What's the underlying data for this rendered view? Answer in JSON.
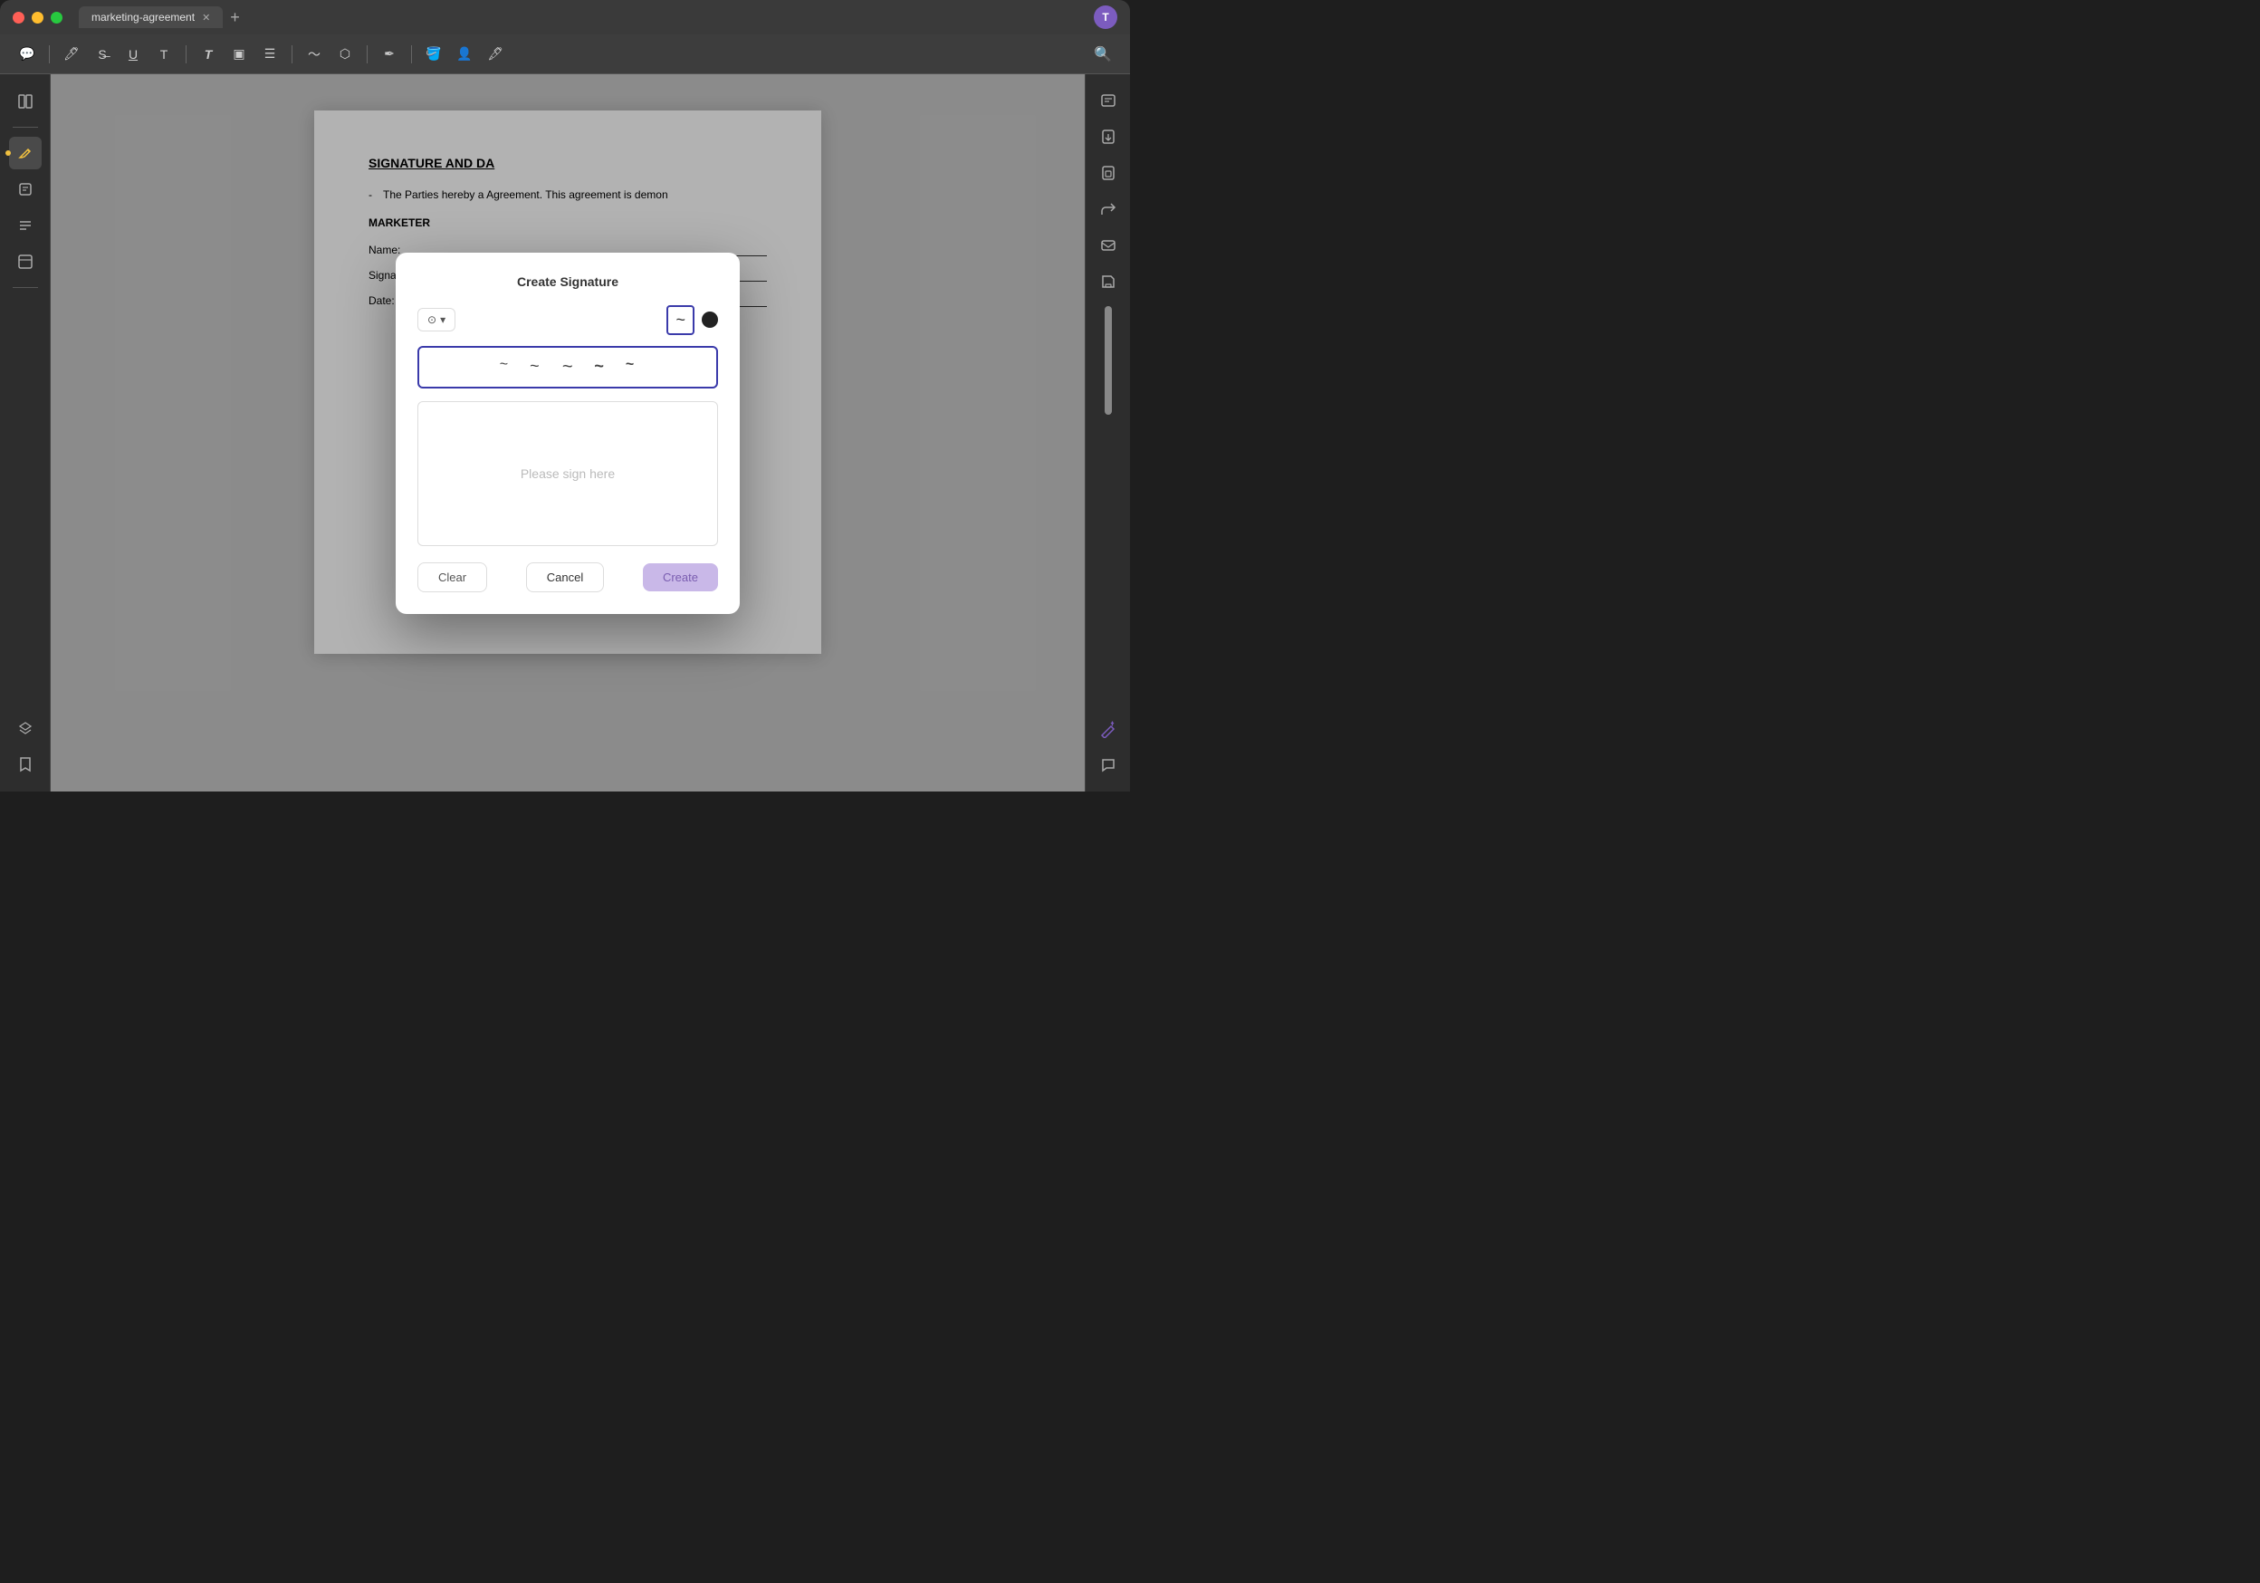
{
  "window": {
    "title": "marketing-agreement",
    "tab_label": "marketing-agreement",
    "avatar_letter": "T"
  },
  "toolbar": {
    "icons": [
      "comment",
      "highlight",
      "strikethrough",
      "underline",
      "text-insert",
      "text-format",
      "text-box",
      "list",
      "draw",
      "shape",
      "pen-tool",
      "fill",
      "person",
      "stamp"
    ],
    "search_label": "search"
  },
  "sidebar_left": {
    "icons": [
      "panel",
      "edit",
      "list",
      "layout",
      "layers",
      "bookmark"
    ]
  },
  "sidebar_right": {
    "icons": [
      "ocr",
      "export-pdf",
      "lock-pdf",
      "share",
      "email",
      "save",
      "magic",
      "chat"
    ]
  },
  "document": {
    "heading": "SIGNATURE AND DA",
    "paragraph_dash": "-",
    "paragraph_text": "The Parties hereby a                                Agreement. This agreement is demon",
    "marketer_label": "MARKETER",
    "name_label": "Name:",
    "signature_label": "Signature:",
    "date_label": "Date:"
  },
  "modal": {
    "title": "Create Signature",
    "pen_tool_label": "⊙",
    "pen_dropdown": "▾",
    "style_selected": "~",
    "style_dot": "●",
    "style_options": [
      "~",
      "~",
      "~",
      "~",
      "~"
    ],
    "canvas_placeholder": "Please sign here",
    "clear_label": "Clear",
    "cancel_label": "Cancel",
    "create_label": "Create"
  },
  "colors": {
    "accent_purple": "#7c5cbf",
    "tab_active": "#4a4a4a",
    "modal_create_bg": "#c9b8e8",
    "modal_create_text": "#7a5db0",
    "selected_border": "#3a3aaa"
  }
}
